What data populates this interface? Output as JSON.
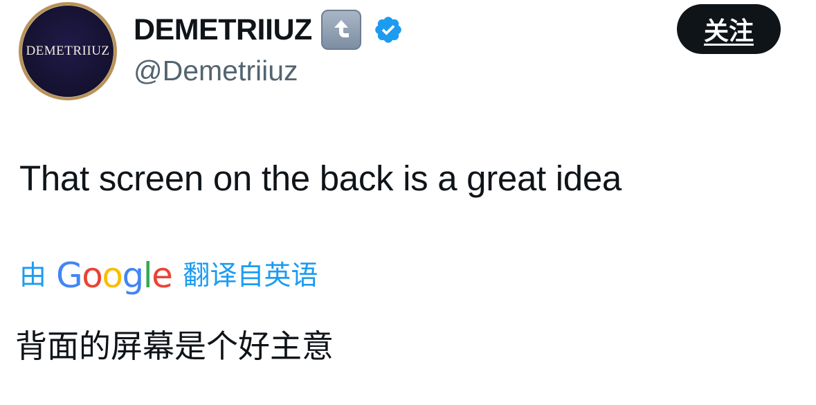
{
  "author": {
    "avatar_text": "DEMETRIIUZ",
    "display_name": "DEMETRIIUZ",
    "handle": "@Demetriiuz",
    "name_emoji": "upward-curved-arrow-emoji",
    "verified_badge": "verified-check-icon",
    "colors": {
      "avatar_background": "#15112f",
      "avatar_ring": "#b8935a",
      "verified": "#1d9bf0"
    }
  },
  "follow_button": {
    "label": "关注",
    "background": "#0f1419",
    "color": "#ffffff"
  },
  "tweet": {
    "text": "That screen on the back is a great idea"
  },
  "translation": {
    "prefix": "由",
    "provider_letters": [
      "G",
      "o",
      "o",
      "g",
      "l",
      "e"
    ],
    "suffix": "翻译自英语",
    "translated_text": "背面的屏幕是个好主意",
    "link_color": "#1d9bf0"
  }
}
